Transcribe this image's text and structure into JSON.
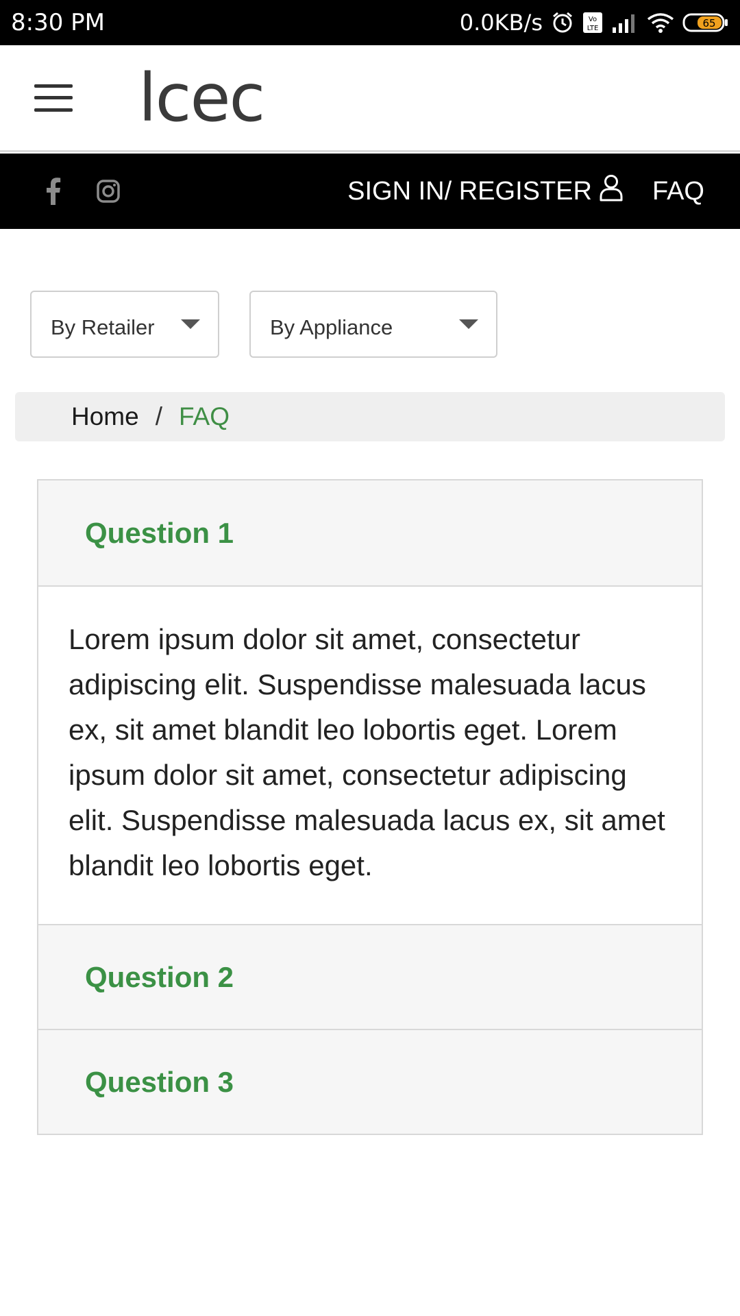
{
  "status_bar": {
    "time": "8:30 PM",
    "speed": "0.0KB/s",
    "battery": "65",
    "icons": [
      "alarm-icon",
      "volte-icon",
      "signal-icon",
      "wifi-icon",
      "battery-icon"
    ]
  },
  "header": {
    "logo": "lcec",
    "menu_icon": "hamburger-menu-icon"
  },
  "top_nav": {
    "social_icons": [
      "facebook-icon",
      "instagram-icon"
    ],
    "signin_label": "SIGN IN/ REGISTER",
    "faq_label": "FAQ"
  },
  "filters": {
    "retailer": "By Retailer",
    "appliance": "By Appliance"
  },
  "breadcrumb": {
    "home": "Home",
    "separator": "/",
    "current": "FAQ"
  },
  "faq": [
    {
      "question": "Question 1",
      "answer": "Lorem ipsum dolor sit amet, consectetur adipiscing elit. Suspendisse malesuada lacus ex, sit amet blandit leo lobortis eget. Lorem ipsum dolor sit amet, consectetur adipiscing elit. Suspendisse malesuada lacus ex, sit amet blandit leo lobortis eget.",
      "expanded": true
    },
    {
      "question": "Question 2",
      "expanded": false
    },
    {
      "question": "Question 3",
      "expanded": false
    }
  ],
  "colors": {
    "accent_green": "#3b9145",
    "nav_black": "#000000",
    "breadcrumb_bg": "#efefef"
  }
}
